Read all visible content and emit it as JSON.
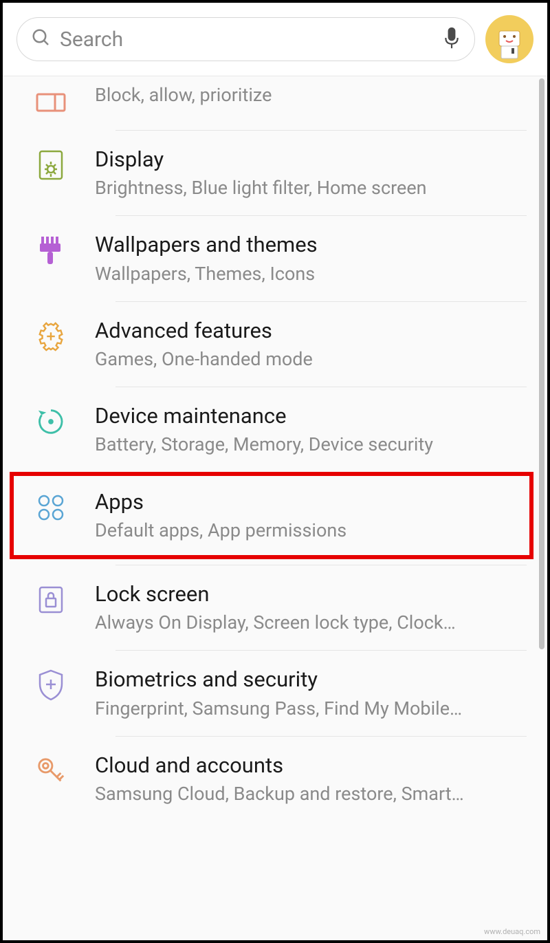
{
  "search": {
    "placeholder": "Search"
  },
  "items": [
    {
      "title": "",
      "subtitle": "Block, allow, prioritize",
      "icon": "notifications-icon",
      "color": "#e8917a"
    },
    {
      "title": "Display",
      "subtitle": "Brightness, Blue light filter, Home screen",
      "icon": "display-icon",
      "color": "#8ca83e"
    },
    {
      "title": "Wallpapers and themes",
      "subtitle": "Wallpapers, Themes, Icons",
      "icon": "brush-icon",
      "color": "#b560d4"
    },
    {
      "title": "Advanced features",
      "subtitle": "Games, One-handed mode",
      "icon": "gear-plus-icon",
      "color": "#e8a53e"
    },
    {
      "title": "Device maintenance",
      "subtitle": "Battery, Storage, Memory, Device security",
      "icon": "refresh-icon",
      "color": "#3ebfa8"
    },
    {
      "title": "Apps",
      "subtitle": "Default apps, App permissions",
      "icon": "apps-icon",
      "color": "#5aa5d4",
      "highlighted": true
    },
    {
      "title": "Lock screen",
      "subtitle": "Always On Display, Screen lock type, Clock…",
      "icon": "lock-icon",
      "color": "#9a8fd4"
    },
    {
      "title": "Biometrics and security",
      "subtitle": "Fingerprint, Samsung Pass, Find My Mobile…",
      "icon": "shield-plus-icon",
      "color": "#9a8fd4"
    },
    {
      "title": "Cloud and accounts",
      "subtitle": "Samsung Cloud, Backup and restore, Smart…",
      "icon": "key-icon",
      "color": "#e89a6a"
    }
  ],
  "watermark": "www.deuaq.com"
}
